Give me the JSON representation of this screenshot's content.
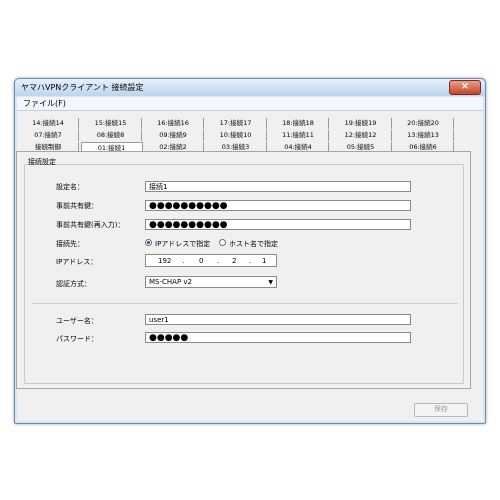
{
  "window": {
    "title": "ヤマハVPNクライアント 接続設定",
    "close_glyph": "×"
  },
  "menu": {
    "file": "ファイル(F)"
  },
  "tabs": {
    "row1": [
      "14:接続14",
      "15:接続15",
      "16:接続16",
      "17:接続17",
      "18:接続18",
      "19:接続19",
      "20:接続20"
    ],
    "row2": [
      "07:接続7",
      "08:接続8",
      "09:接続9",
      "10:接続10",
      "11:接続11",
      "12:接続12",
      "13:接続13"
    ],
    "row3": [
      "接続制御",
      "01:接続1",
      "02:接続2",
      "03:接続3",
      "04:接続4",
      "05:接続5",
      "06:接続6"
    ]
  },
  "group": {
    "label": "接続設定"
  },
  "form": {
    "setting_name_label": "設定名：",
    "setting_name_value": "接続1",
    "psk_label": "事前共有鍵：",
    "psk_value": "●●●●●●●●●●",
    "psk_confirm_label": "事前共有鍵(再入力)：",
    "psk_confirm_value": "●●●●●●●●●●",
    "destination_label": "接続先：",
    "radio_ip_label": "IPアドレスで指定",
    "radio_host_label": "ホスト名で指定",
    "ip_label": "IPアドレス：",
    "ip": [
      "192",
      "0",
      "2",
      "1"
    ],
    "auth_label": "認証方式：",
    "auth_value": "MS-CHAP v2",
    "username_label": "ユーザー名：",
    "username_value": "user1",
    "password_label": "パスワード：",
    "password_value": "●●●●●"
  },
  "footer": {
    "save_label": "保存"
  }
}
